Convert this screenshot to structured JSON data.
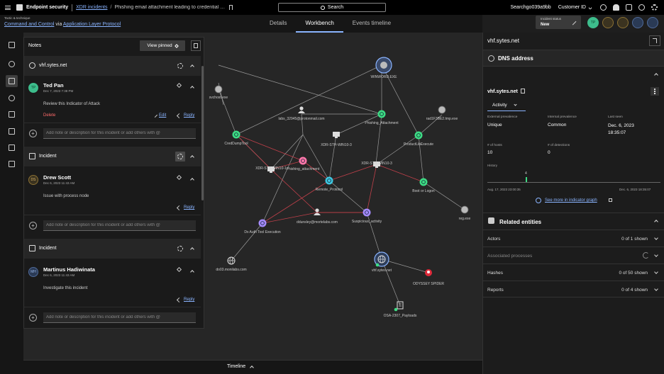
{
  "topbar": {
    "brand": "Endpoint security",
    "breadcrumb_link": "XDR incidents",
    "breadcrumb_current": "Phishing email attachment leading to credential d...",
    "search_label": "Search",
    "user": "Searchgo039a9bb",
    "customer": "Customer ID"
  },
  "subheader": {
    "tactics_small": "Tactic & technique",
    "tactic": "Command and Control",
    "via": " via ",
    "technique": "Application Layer Protocol",
    "tabs": [
      "Details",
      "Workbench",
      "Events timeline"
    ],
    "active_tab": "Workbench",
    "status_label": "Incident status",
    "status_value": "New",
    "avatar_initials": "TP"
  },
  "notes": {
    "title": "Notes",
    "view_pinned": "View pinned",
    "groups": [
      {
        "header": "vhf.sytes.net",
        "author": "Ted Pan",
        "initials": "TP",
        "date": "Dec 7, 2023 7:38 PM",
        "text": "Review this Indicator of Attack",
        "delete": "Delete",
        "edit": "Edit",
        "reply": "Reply"
      },
      {
        "header": "Incident",
        "author": "Drew Scott",
        "initials": "DS",
        "date": "Dec 6, 2023 11:43 AM",
        "text": "Issue with process node",
        "reply": "Reply"
      },
      {
        "header": "Incident",
        "author": "Martinus Hadiwinata",
        "initials": "MH",
        "date": "Dec 6, 2023 11:43 AM",
        "text": "Investigate this incident",
        "reply": "Reply"
      }
    ],
    "add_placeholder": "Add note or description for this incident or add others with @"
  },
  "graph": {
    "nodes": [
      {
        "id": "winword",
        "label": "WINWORD.EXE",
        "kind": "root"
      },
      {
        "id": "svchost",
        "label": "svchost.exe",
        "kind": "grey"
      },
      {
        "id": "email",
        "label": "labs_32945@protonmail.com",
        "kind": "user"
      },
      {
        "id": "phish1",
        "label": "Phishing_Attachment",
        "kind": "green"
      },
      {
        "id": "rad",
        "label": "rad1F3BE2.tmp.exe",
        "kind": "grey"
      },
      {
        "id": "credump",
        "label": "CredDumpTool",
        "kind": "green"
      },
      {
        "id": "xdr3a",
        "label": "XDR-STH-WIN10-3",
        "kind": "host"
      },
      {
        "id": "prodexec",
        "label": "ProductLibExecute",
        "kind": "green"
      },
      {
        "id": "phish2",
        "label": "Phishing_attachment",
        "kind": "pink"
      },
      {
        "id": "xdr1",
        "label": "XDR-STH-WIN10-1",
        "kind": "host"
      },
      {
        "id": "xdr3b",
        "label": "XDR-STH-WIN10-3",
        "kind": "host"
      },
      {
        "id": "remote",
        "label": "Remote_Protocol",
        "kind": "cyan"
      },
      {
        "id": "bootlog",
        "label": "Boot or Logon",
        "kind": "green"
      },
      {
        "id": "reg",
        "label": "reg.exe",
        "kind": "grey"
      },
      {
        "id": "suspicious",
        "label": "Suspicious_activity",
        "kind": "purple"
      },
      {
        "id": "duser",
        "label": "ddunsley@mortelabs.com",
        "kind": "user"
      },
      {
        "id": "dxauth",
        "label": "Dx Auth Tool Execution",
        "kind": "purple"
      },
      {
        "id": "do03",
        "label": "do03.monilabs.com",
        "kind": "globe"
      },
      {
        "id": "vhf",
        "label": "vhf.sytes.net",
        "kind": "globe"
      },
      {
        "id": "odyssey",
        "label": "ODYSSEY SPIDER",
        "kind": "spider"
      },
      {
        "id": "osa",
        "label": "OSA-2307_Payloads",
        "kind": "doc"
      }
    ]
  },
  "timeline": {
    "label": "Timeline"
  },
  "right_panel": {
    "title": "vhf.sytes.net",
    "section": "DNS address",
    "domain": "vhf.sytes.net",
    "tab": "Activity",
    "stats": [
      {
        "label": "External prevalence",
        "value": "Unique"
      },
      {
        "label": "Internal prevalence",
        "value": "Common"
      },
      {
        "label": "Last seen",
        "value": "Dec. 6, 2023 18:35:07"
      },
      {
        "label": "# of hosts",
        "value": "10"
      },
      {
        "label": "# of detections",
        "value": "0"
      }
    ],
    "history_label": "History",
    "history_peak": "4",
    "history_start": "Aug. 17, 2023 23:00:35",
    "history_end": "Dec. 6, 2023 18:35:07",
    "see_more": "See more in indicator graph",
    "related_title": "Related entities",
    "related": [
      {
        "label": "Actors",
        "value": "0 of 1 shown"
      },
      {
        "label": "Associated processes",
        "value": ""
      },
      {
        "label": "Hashes",
        "value": "0 of 50 shown"
      },
      {
        "label": "Reports",
        "value": "0 of 4 shown"
      }
    ]
  },
  "colors": {
    "accent": "#8ab4ff",
    "green_node": "#3ddc84",
    "pink_node": "#ff77aa",
    "cyan_node": "#3ec7e0",
    "purple_node": "#a58bff",
    "red_edge": "#c0404a",
    "delete": "#ff6b6b"
  }
}
